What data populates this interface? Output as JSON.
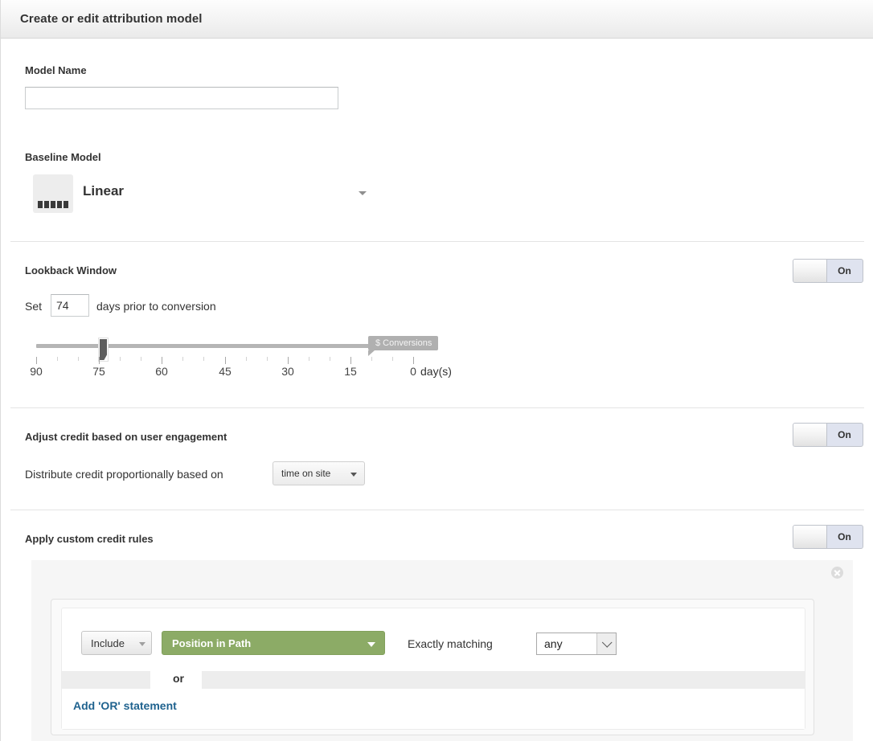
{
  "header": {
    "title": "Create or edit attribution model"
  },
  "model_name": {
    "label": "Model Name",
    "value": "",
    "placeholder": ""
  },
  "baseline_model": {
    "label": "Baseline Model",
    "selected": "Linear",
    "icon": "linear-model-bars-icon",
    "caret": "chevron-down-icon"
  },
  "lookback_window": {
    "label": "Lookback Window",
    "toggle_state": "On",
    "prefix_text": "Set",
    "days_value": "74",
    "suffix_text": "days prior to conversion",
    "slider": {
      "min": 0,
      "max": 90,
      "value": 74,
      "flag_label": "$ Conversions",
      "major_ticks": [
        "90",
        "75",
        "60",
        "45",
        "30",
        "15",
        "0"
      ],
      "unit_label": "day(s)"
    }
  },
  "engagement": {
    "label": "Adjust credit based on user engagement",
    "toggle_state": "On",
    "description": "Distribute credit proportionally based on",
    "metric_selected": "time on site"
  },
  "custom_credit_rules": {
    "label": "Apply custom credit rules",
    "toggle_state": "On",
    "close_icon": "close-icon",
    "rule": {
      "include_label": "Include",
      "dimension_label": "Position in Path",
      "match_type_text": "Exactly matching",
      "match_value": "any",
      "or_word": "or",
      "add_or_link": "Add 'OR' statement"
    }
  },
  "colors": {
    "green_accent": "#8cab66",
    "link_blue": "#20638f",
    "toggle_on_bg": "#dfe3ef",
    "slider_track": "#b5b5b5",
    "flag_gray": "#b0b0b0"
  }
}
